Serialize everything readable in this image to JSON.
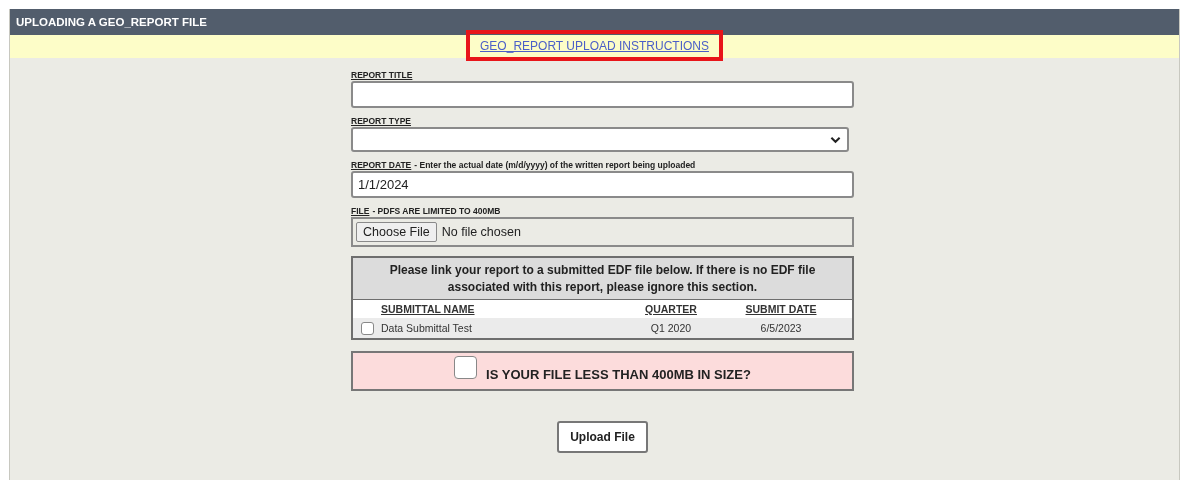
{
  "header": {
    "title": "UPLOADING A GEO_REPORT FILE"
  },
  "instructions_link": {
    "label": "GEO_REPORT UPLOAD INSTRUCTIONS",
    "highlighted": true
  },
  "fields": [
    {
      "kind": "text",
      "label": "REPORT TITLE"
    },
    {
      "kind": "select",
      "label": "REPORT TYPE"
    },
    {
      "kind": "text",
      "label": "REPORT DATE",
      "hint": "- Enter the actual date (m/d/yyyy) of the written report being uploaded",
      "value": "1/1/2024"
    },
    {
      "kind": "file",
      "label": "FILE",
      "hint": "- PDFS ARE LIMITED TO 400MB",
      "button": "Choose File",
      "status": "No file chosen"
    }
  ],
  "edf_table": {
    "notice": "Please link your report to a submitted EDF file below. If there is no EDF file associated with this report, please ignore this section.",
    "columns": [
      "SUBMITTAL NAME",
      "QUARTER",
      "SUBMIT DATE"
    ],
    "rows": [
      {
        "checked": false,
        "cells": [
          "Data Submittal Test",
          "Q1 2020",
          "6/5/2023"
        ]
      }
    ]
  },
  "size_confirm": {
    "label": "IS YOUR FILE LESS THAN 400MB IN SIZE?",
    "checked": false
  },
  "submit": {
    "label": "Upload File"
  }
}
